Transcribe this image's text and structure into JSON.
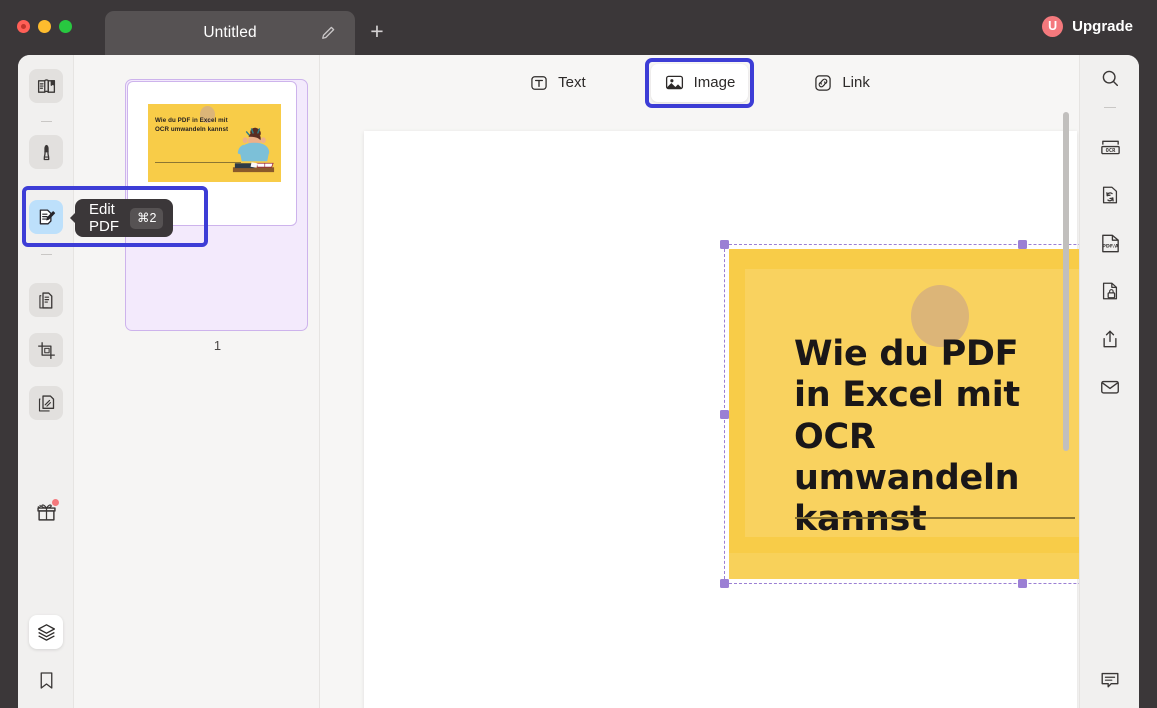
{
  "window": {
    "traffic_lights": [
      "close",
      "minimize",
      "zoom"
    ],
    "tab_title": "Untitled",
    "new_tab_label": "+",
    "upgrade": {
      "badge": "U",
      "label": "Upgrade"
    }
  },
  "colors": {
    "accent_blue": "#3d3dd6",
    "selection_purple": "#9b7fd4",
    "hero_yellow": "#f8cc48",
    "upgrade_pink": "#f4797d",
    "titlebar_dark": "#3b3739",
    "tooltip_dark": "#3b3739",
    "thumb_lavender": "#f3eafc"
  },
  "left_rail": {
    "items": [
      {
        "name": "reader-mode-icon",
        "label": "Reader Mode",
        "state": "normal"
      },
      {
        "name": "highlighter-icon",
        "label": "Annotate",
        "state": "normal"
      },
      {
        "name": "edit-pdf-icon",
        "label": "Edit PDF",
        "state": "active"
      },
      {
        "name": "organize-pages-icon",
        "label": "Organize Pages",
        "state": "normal"
      },
      {
        "name": "crop-icon",
        "label": "Crop",
        "state": "normal"
      },
      {
        "name": "compress-icon",
        "label": "Compress",
        "state": "normal"
      },
      {
        "name": "gift-icon",
        "label": "What's New",
        "state": "notify"
      },
      {
        "name": "layers-icon",
        "label": "Layers",
        "state": "selected"
      },
      {
        "name": "bookmark-icon",
        "label": "Bookmarks",
        "state": "normal"
      }
    ]
  },
  "tooltip": {
    "label": "Edit PDF",
    "shortcut": "⌘2"
  },
  "thumbnails": {
    "pages": [
      {
        "page_number": "1",
        "headline": "Wie du PDF in Excel mit OCR umwandeln kannst",
        "selected": true
      }
    ]
  },
  "edit_toolbar": {
    "items": [
      {
        "name": "text-tool",
        "label": "Text",
        "icon": "text-box-icon",
        "selected": false
      },
      {
        "name": "image-tool",
        "label": "Image",
        "icon": "image-icon",
        "selected": true
      },
      {
        "name": "link-tool",
        "label": "Link",
        "icon": "link-chain-icon",
        "selected": false
      }
    ]
  },
  "document": {
    "hero_image": {
      "headline": "Wie du PDF in Excel mit OCR umwandeln kannst",
      "background_color": "#f8cc48",
      "selected": true,
      "handle_count": 8
    }
  },
  "right_rail": {
    "items": [
      {
        "name": "search-icon",
        "label": "Search"
      },
      {
        "name": "ocr-icon",
        "label": "OCR"
      },
      {
        "name": "convert-icon",
        "label": "Convert"
      },
      {
        "name": "pdfa-icon",
        "label": "PDF/A"
      },
      {
        "name": "protect-icon",
        "label": "Protect"
      },
      {
        "name": "share-icon",
        "label": "Share"
      },
      {
        "name": "email-icon",
        "label": "Email"
      },
      {
        "name": "comment-icon",
        "label": "Comments"
      }
    ]
  }
}
